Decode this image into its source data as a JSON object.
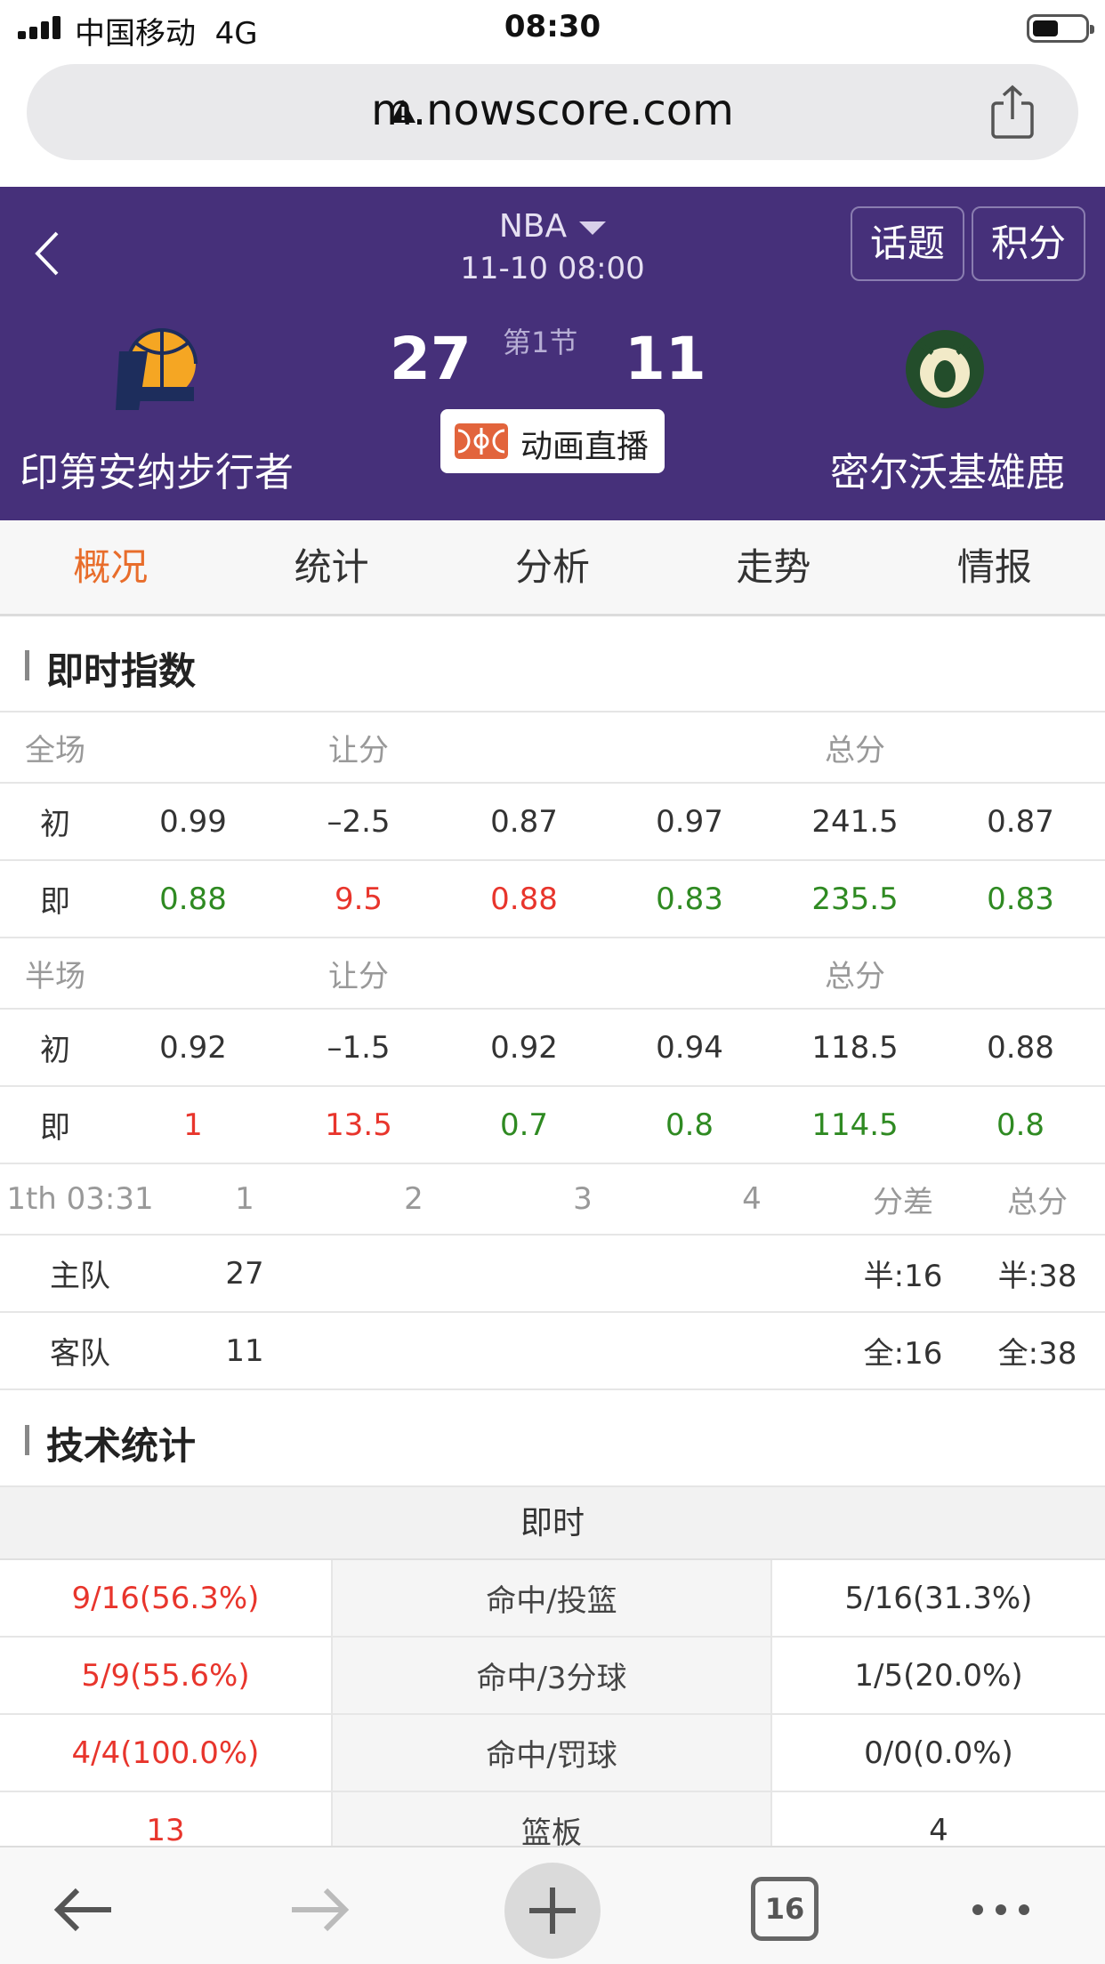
{
  "status_bar": {
    "carrier": "中国移动",
    "network": "4G",
    "time": "08:30"
  },
  "browser": {
    "url": "m.nowscore.com",
    "tab_count": "16"
  },
  "header": {
    "league": "NBA",
    "match_time": "11-10 08:00",
    "topic_button": "话题",
    "points_button": "积分",
    "home_team": "印第安纳步行者",
    "away_team": "密尔沃基雄鹿",
    "home_score": "27",
    "away_score": "11",
    "period": "第1节",
    "live_animation": "动画直播"
  },
  "tabs": [
    "概况",
    "统计",
    "分析",
    "走势",
    "情报"
  ],
  "odds_section": {
    "title": "即时指数",
    "full": {
      "label": "全场",
      "handicap_label": "让分",
      "total_label": "总分",
      "initial": {
        "label": "初",
        "values": [
          "0.99",
          "–2.5",
          "0.87",
          "0.97",
          "241.5",
          "0.87"
        ]
      },
      "live": {
        "label": "即",
        "values": [
          "0.88",
          "9.5",
          "0.88",
          "0.83",
          "235.5",
          "0.83"
        ]
      }
    },
    "half": {
      "label": "半场",
      "handicap_label": "让分",
      "total_label": "总分",
      "initial": {
        "label": "初",
        "values": [
          "0.92",
          "–1.5",
          "0.92",
          "0.94",
          "118.5",
          "0.88"
        ]
      },
      "live": {
        "label": "即",
        "values": [
          "1",
          "13.5",
          "0.7",
          "0.8",
          "114.5",
          "0.8"
        ]
      }
    }
  },
  "score_table": {
    "headers": [
      "1th 03:31",
      "1",
      "2",
      "3",
      "4",
      "分差",
      "总分"
    ],
    "rows": [
      {
        "team": "主队",
        "q1": "27",
        "q2": "",
        "q3": "",
        "q4": "",
        "diff": "半:16",
        "total": "半:38"
      },
      {
        "team": "客队",
        "q1": "11",
        "q2": "",
        "q3": "",
        "q4": "",
        "diff": "全:16",
        "total": "全:38"
      }
    ]
  },
  "tech_section": {
    "title": "技术统计",
    "subheader": "即时",
    "rows": [
      {
        "home": "9/16(56.3%)",
        "label": "命中/投篮",
        "away": "5/16(31.3%)"
      },
      {
        "home": "5/9(55.6%)",
        "label": "命中/3分球",
        "away": "1/5(20.0%)"
      },
      {
        "home": "4/4(100.0%)",
        "label": "命中/罚球",
        "away": "0/0(0.0%)"
      },
      {
        "home": "13",
        "label": "篮板",
        "away": "4"
      }
    ]
  },
  "colors": {
    "header_bg": "#46307a",
    "active_tab": "#e86d2b",
    "up": "#e8352c",
    "down": "#2f8a22"
  }
}
